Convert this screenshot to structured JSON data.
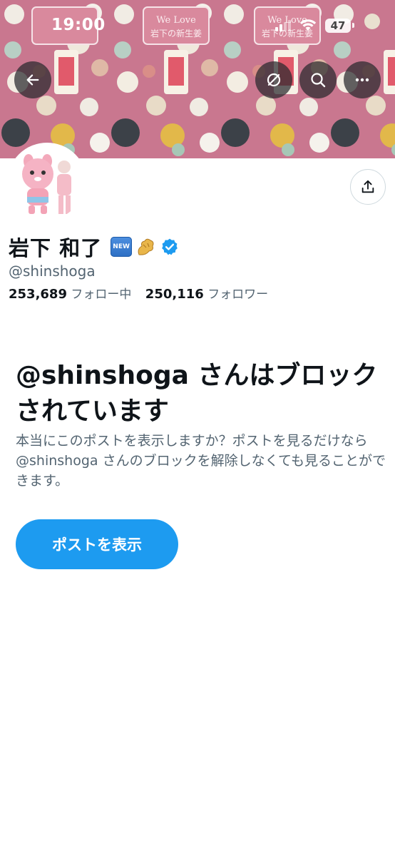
{
  "status_bar": {
    "time": "19:00",
    "battery": "47"
  },
  "banner": {
    "sign_line1": "We Love",
    "sign_line2": "岩下の新生姜",
    "bg_color": "#c9778f"
  },
  "profile": {
    "display_name": "岩下 和了",
    "new_badge": "NEW",
    "handle": "@shinshoga",
    "following_count": "253,689",
    "following_label": "フォロー中",
    "followers_count": "250,116",
    "followers_label": "フォロワー",
    "verified_color": "#1d9bf0"
  },
  "blocked": {
    "title": "@shinshoga さんはブロックされています",
    "description": "本当にこのポストを表示しますか？ポストを見るだけなら @shinshoga さんのブロックを解除しなくても見ることができます。",
    "button_label": "ポストを表示"
  },
  "icons": [
    "back-arrow-icon",
    "unmute-icon",
    "search-icon",
    "more-icon",
    "share-icon",
    "ginger-icon",
    "verified-icon",
    "signal-icon",
    "wifi-icon",
    "battery-icon"
  ],
  "colors": {
    "accent": "#1d9bf0",
    "text": "#0f1419",
    "secondary_text": "#536471"
  }
}
